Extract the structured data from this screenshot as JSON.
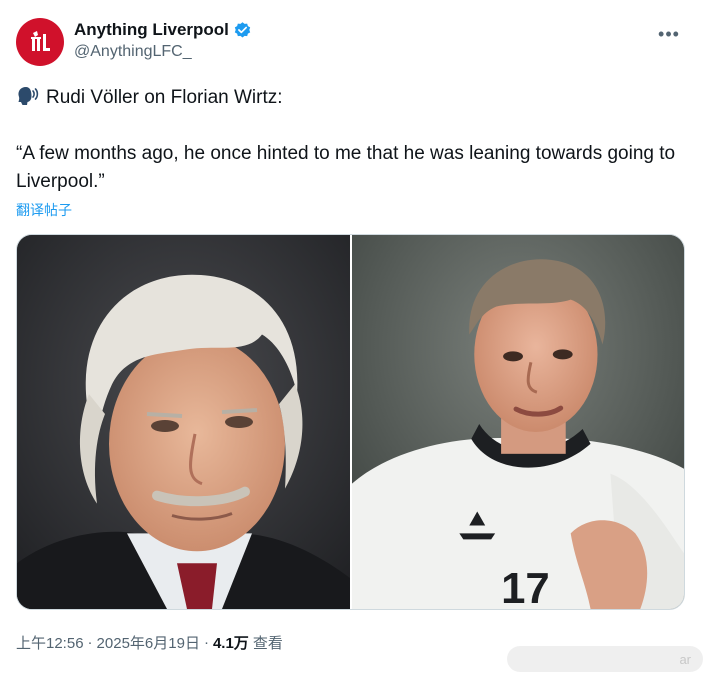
{
  "author": {
    "display_name": "Anything Liverpool",
    "handle": "@AnythingLFC_",
    "verified": true,
    "avatar_icon": "liverbird-logo",
    "avatar_color": "#d0112b"
  },
  "more_icon": "more-icon",
  "tweet": {
    "line1": "Rudi Völler on Florian Wirtz:",
    "quote": "“A few months ago, he once hinted to me that he was leaning towards going to Liverpool.”",
    "emoji": "speaking-head-icon"
  },
  "translate_label": "翻译帖子",
  "media": {
    "left_subject": "Rudi Völler photo",
    "right_subject": "Florian Wirtz photo"
  },
  "meta": {
    "time": "上午12:56",
    "sep1": "·",
    "date": "2025年6月19日",
    "sep2": "·",
    "views_count": "4.1万",
    "views_label": "查看"
  },
  "watermark": "ar",
  "colors": {
    "accent": "#1d9bf0",
    "text": "#0f1419",
    "muted": "#536471"
  }
}
